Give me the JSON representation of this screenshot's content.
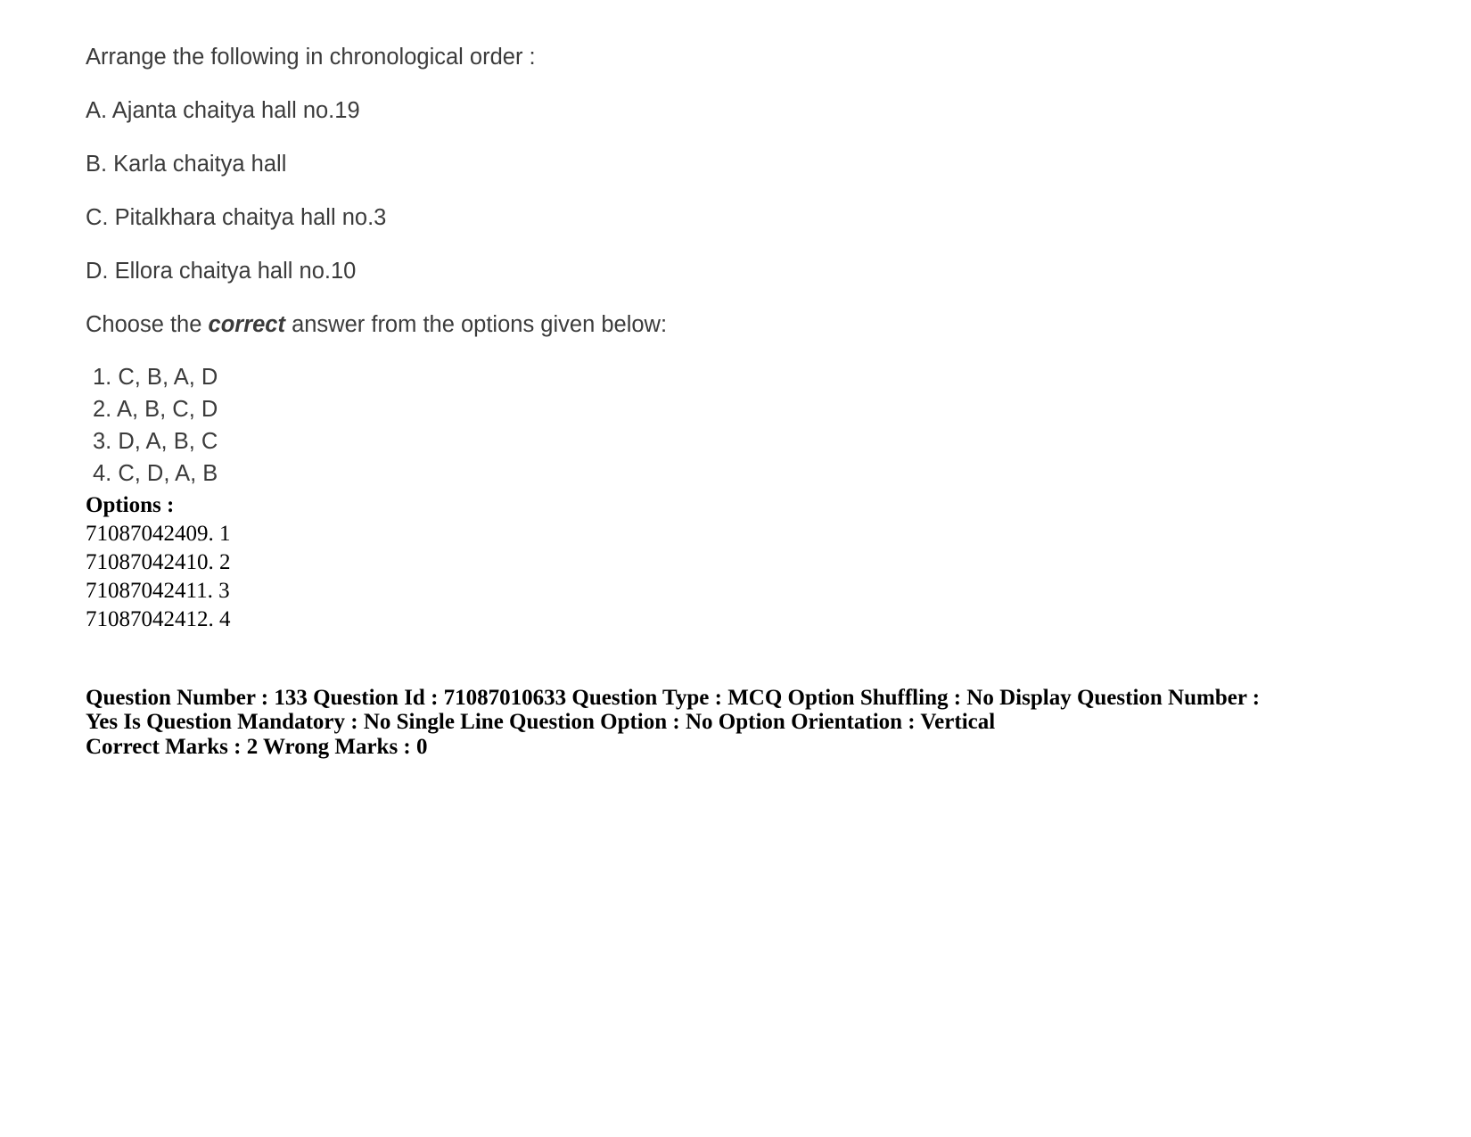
{
  "question": {
    "stem": "Arrange the following in chronological order :",
    "items": [
      "A. Ajanta chaitya hall no.19",
      "B. Karla chaitya hall",
      "C. Pitalkhara chaitya hall no.3",
      "D. Ellora chaitya hall no.10"
    ],
    "instruction_prefix": "Choose the ",
    "instruction_emphasis": "correct",
    "instruction_suffix": " answer from the options given below:",
    "answers": [
      "1. C, B, A, D",
      "2. A, B, C, D",
      "3. D, A, B, C",
      "4. C, D, A, B"
    ]
  },
  "options": {
    "heading": "Options :",
    "entries": [
      "71087042409. 1",
      "71087042410. 2",
      "71087042411. 3",
      "71087042412. 4"
    ]
  },
  "metadata": {
    "line1": "Question Number : 133 Question Id : 71087010633 Question Type : MCQ Option Shuffling : No Display Question Number : Yes Is Question Mandatory : No Single Line Question Option : No Option Orientation : Vertical",
    "line2": "Correct Marks : 2 Wrong Marks : 0"
  }
}
